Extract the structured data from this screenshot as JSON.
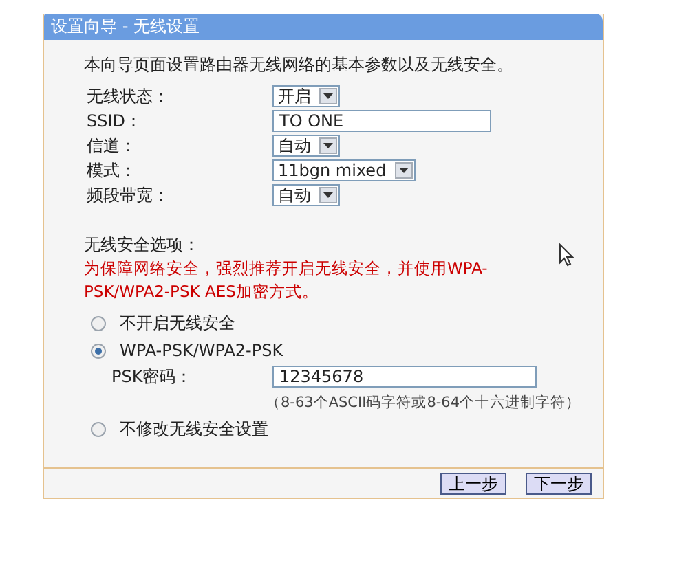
{
  "window": {
    "title": "设置向导 - 无线设置"
  },
  "intro": "本向导页面设置路由器无线网络的基本参数以及无线安全。",
  "fields": [
    {
      "kind": "select",
      "label": "无线状态：",
      "value": "开启"
    },
    {
      "kind": "text",
      "label": "SSID：",
      "value": "TO ONE"
    },
    {
      "kind": "select",
      "label": "信道：",
      "value": "自动"
    },
    {
      "kind": "select",
      "label": "模式：",
      "value": "11bgn mixed"
    },
    {
      "kind": "select",
      "label": "频段带宽：",
      "value": "自动"
    }
  ],
  "security": {
    "title": "无线安全选项：",
    "warning": "为保障网络安全，强烈推荐开启无线安全，并使用WPA-PSK/WPA2-PSK AES加密方式。",
    "options": [
      {
        "label": "不开启无线安全",
        "selected": false
      },
      {
        "label": "WPA-PSK/WPA2-PSK",
        "selected": true,
        "psk": {
          "label": "PSK密码：",
          "value": "12345678",
          "hint": "（8-63个ASCII码字符或8-64个十六进制字符）"
        }
      },
      {
        "label": "不修改无线安全设置",
        "selected": false
      }
    ]
  },
  "buttons": [
    "上一步",
    "下一步"
  ]
}
